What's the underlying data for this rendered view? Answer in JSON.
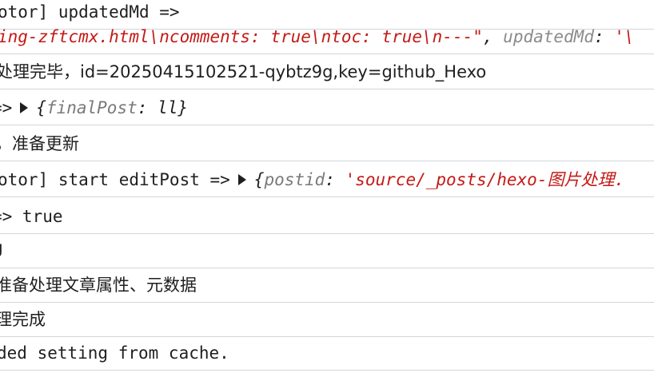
{
  "console": {
    "rows": [
      {
        "a": "otor] updatedMd =>"
      },
      {
        "s1": "ing-zftcmx.html\\ncomments: true\\ntoc: true\\n---\"",
        "s2": ", ",
        "k1": "updatedMd",
        "s3": ": ",
        "s4": "'\\"
      },
      {
        "a": "处理完毕，id=20250415102521-qybtz9g,key=github_Hexo"
      },
      {
        "a": "=>",
        "obj_open": "{",
        "k": "finalPost",
        "sep": ": ",
        "v": "ll",
        "obj_close": "}"
      },
      {
        "a": "，准备更新"
      },
      {
        "a": "otor] start editPost =>",
        "obj_open": "{",
        "k": "postid",
        "sep": ": ",
        "v": "'source/_posts/hexo-图片处理."
      },
      {
        "a": "=> true"
      },
      {
        "a": "J"
      },
      {
        "a": "准备处理文章属性、元数据"
      },
      {
        "a": "理完成"
      },
      {
        "a": "ded setting from cache."
      }
    ]
  },
  "colors": {
    "string": "#c41a16",
    "key": "#8b8b8b",
    "divider": "#d0d7de"
  }
}
